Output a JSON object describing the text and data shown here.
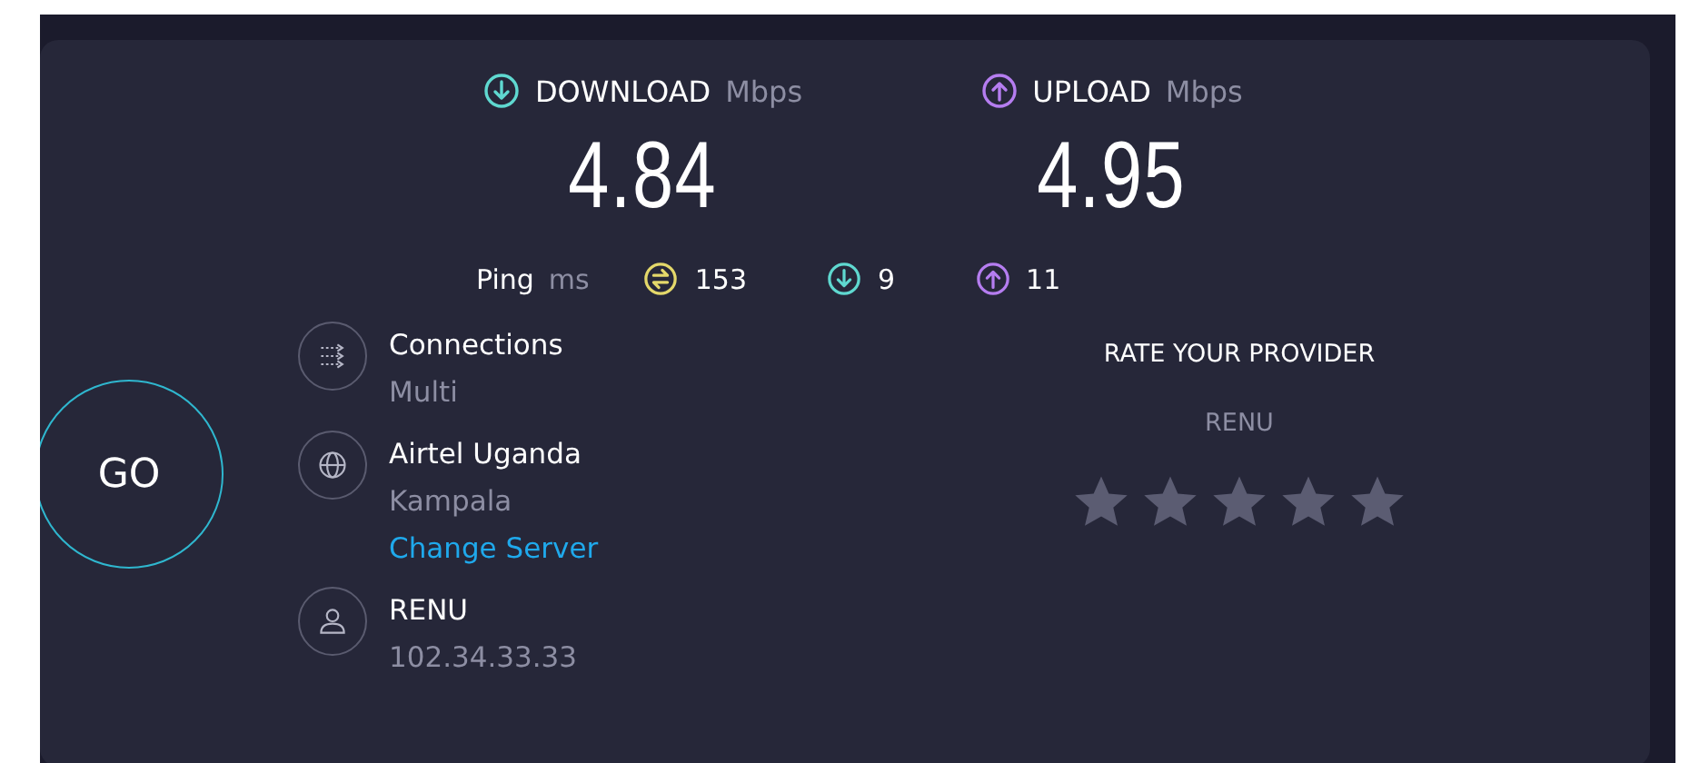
{
  "speeds": [
    {
      "kind": "download",
      "label": "DOWNLOAD",
      "unit": "Mbps",
      "value": "4.84"
    },
    {
      "kind": "upload",
      "label": "UPLOAD",
      "unit": "Mbps",
      "value": "4.95"
    }
  ],
  "ping": {
    "label": "Ping",
    "unit": "ms",
    "readings": [
      {
        "kind": "idle",
        "value": "153"
      },
      {
        "kind": "download",
        "value": "9"
      },
      {
        "kind": "upload",
        "value": "11"
      }
    ]
  },
  "go_button": "GO",
  "info": [
    {
      "kind": "connections",
      "title": "Connections",
      "subtitle": "Multi"
    },
    {
      "kind": "server",
      "title": "Airtel Uganda",
      "subtitle": "Kampala",
      "link": "Change Server"
    },
    {
      "kind": "user",
      "title": "RENU",
      "subtitle": "102.34.33.33"
    }
  ],
  "rating": {
    "title": "RATE YOUR PROVIDER",
    "provider": "RENU",
    "stars": 0
  }
}
